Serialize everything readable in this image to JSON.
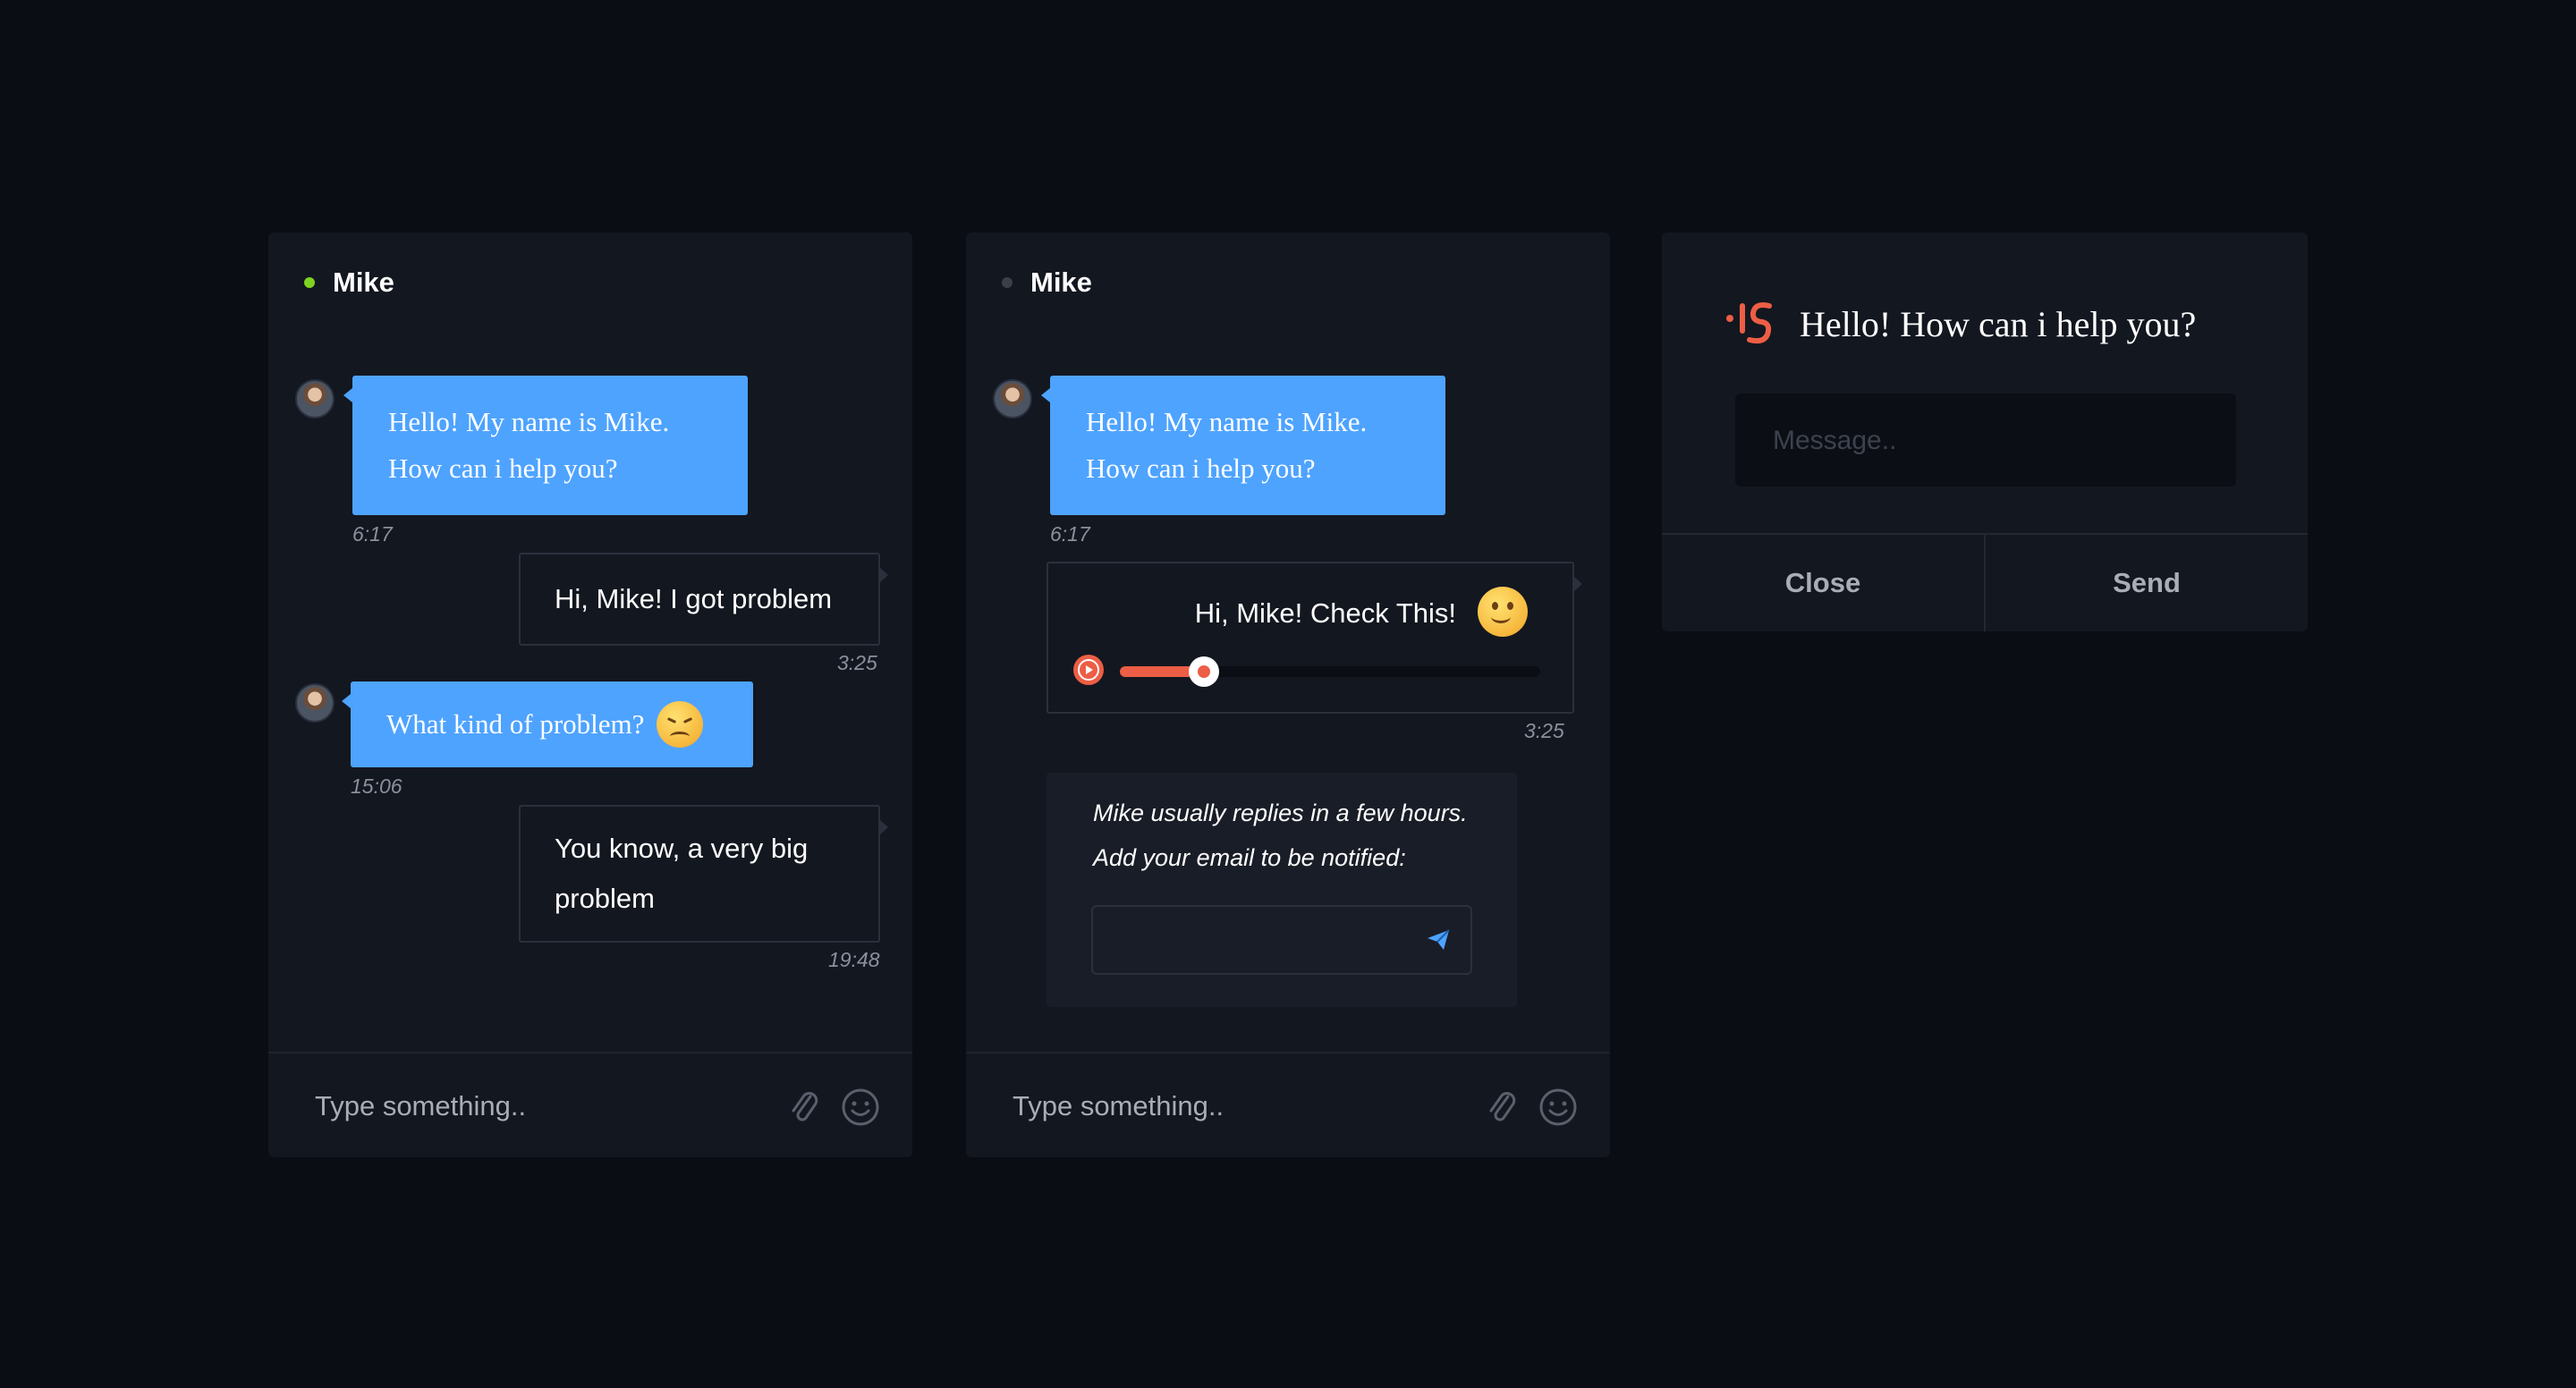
{
  "colors": {
    "background": "#0a0d14",
    "panel": "#131720",
    "incoming_bubble": "#4ea3ff",
    "accent": "#ec5e45",
    "online_dot": "#7ed321",
    "offline_dot": "#3a3f4a"
  },
  "chat_a": {
    "contact_name": "Mike",
    "status": "online",
    "messages": [
      {
        "direction": "in",
        "lines": [
          "Hello! My name is Mike.",
          "How can i help you?"
        ],
        "time": "6:17"
      },
      {
        "direction": "out",
        "text": "Hi, Mike! I got problem",
        "time": "3:25"
      },
      {
        "direction": "in",
        "text": "What kind of problem?",
        "emoji": "confounded-face-icon",
        "time": "15:06"
      },
      {
        "direction": "out",
        "lines": [
          "You know, a very big",
          "problem"
        ],
        "time": "19:48"
      }
    ],
    "composer_placeholder": "Type something.."
  },
  "chat_b": {
    "contact_name": "Mike",
    "status": "offline",
    "messages": [
      {
        "direction": "in",
        "lines": [
          "Hello! My name is Mike.",
          "How can i help you?"
        ],
        "time": "6:17"
      },
      {
        "direction": "out",
        "text": "Hi, Mike! Check This!",
        "emoji": "slightly-smiling-face-icon",
        "audio_progress": 0.2,
        "time": "3:25"
      }
    ],
    "notify": {
      "line1": "Mike usually replies in a few hours.",
      "line2": "Add your email to be notified:"
    },
    "composer_placeholder": "Type something.."
  },
  "widget": {
    "greeting": "Hello! How can i help you?",
    "message_placeholder": "Message..",
    "close_label": "Close",
    "send_label": "Send"
  }
}
